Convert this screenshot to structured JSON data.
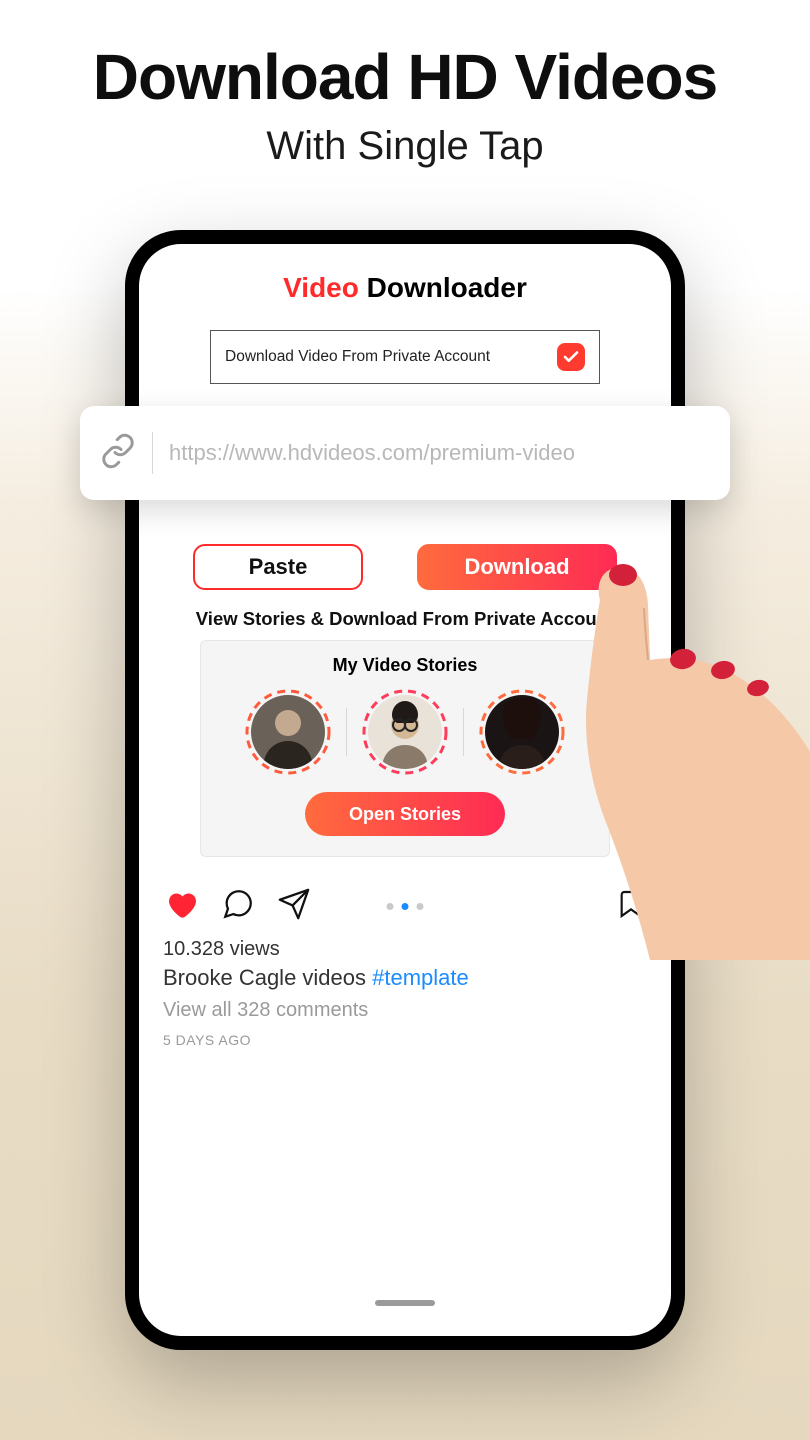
{
  "hero": {
    "title": "Download HD Videos",
    "subtitle": "With Single Tap"
  },
  "app": {
    "title_red": "Video",
    "title_black": " Downloader",
    "private_label": "Download Video From Private Account",
    "url_placeholder": "https://www.hdvideos.com/premium-video",
    "paste_label": "Paste",
    "download_label": "Download",
    "section_label": "View Stories & Download From Private Account",
    "stories_title": "My Video Stories",
    "open_stories_label": "Open Stories"
  },
  "post": {
    "views": "10.328 views",
    "caption_text": "Brooke Cagle videos ",
    "caption_tag": "#template",
    "comments": "View all 328 comments",
    "age": "5 DAYS AGO"
  }
}
